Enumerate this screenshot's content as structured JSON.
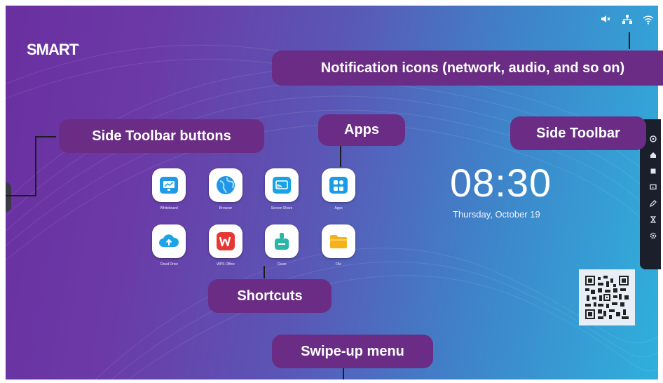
{
  "screen": {
    "logo": "SMART",
    "logo_mark": ".",
    "clock": {
      "time": "08:30",
      "date": "Thursday, October 19"
    }
  },
  "status_icons": [
    "mute-icon",
    "network-icon",
    "wifi-icon"
  ],
  "apps": [
    {
      "label": "Whiteboard",
      "icon": "whiteboard-icon",
      "color": "#1d9be8"
    },
    {
      "label": "Browser",
      "icon": "browser-icon",
      "color": "#2196e6"
    },
    {
      "label": "Screen Share",
      "icon": "screen-share-icon",
      "color": "#17a3e6"
    },
    {
      "label": "Apps",
      "icon": "apps-icon",
      "color": "#1a9be6"
    },
    {
      "label": "Cloud Drive",
      "icon": "cloud-upload-icon",
      "color": "#1ea3e8"
    },
    {
      "label": "WPS Office",
      "icon": "wps-office-icon",
      "color": "#e53935"
    },
    {
      "label": "Clean",
      "icon": "clean-icon",
      "color": "#29b6a6"
    },
    {
      "label": "File",
      "icon": "file-folder-icon",
      "color": "#f6b21a"
    }
  ],
  "side_toolbar_icons": [
    "settings-icon",
    "home-icon",
    "square-icon",
    "screen-icon",
    "edit-icon",
    "hourglass-icon",
    "gear-icon"
  ],
  "callouts": {
    "notification": "Notification icons (network, audio, and so on)",
    "side_toolbar_buttons": "Side Toolbar buttons",
    "apps": "Apps",
    "side_toolbar": "Side Toolbar",
    "shortcuts": "Shortcuts",
    "swipe_up": "Swipe-up menu"
  },
  "colors": {
    "callout_bg": "#6a2c84",
    "toolbar_bg": "#1a1f2b"
  }
}
